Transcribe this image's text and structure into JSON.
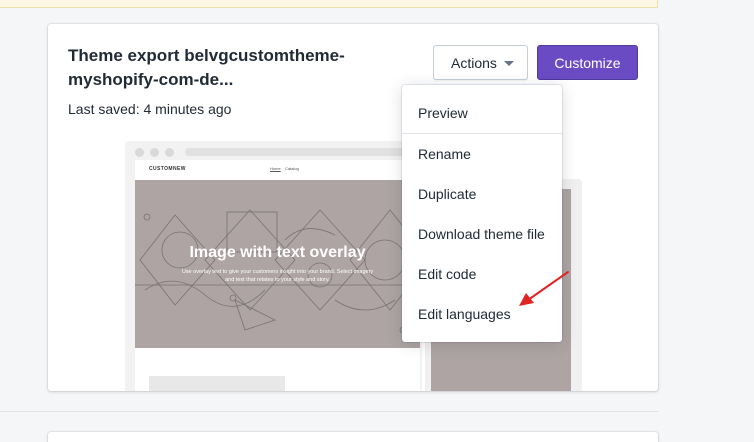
{
  "theme": {
    "title": "Theme export belvgcustomtheme-myshopify-com-de...",
    "last_saved": "Last saved: 4 minutes ago"
  },
  "buttons": {
    "actions_label": "Actions",
    "customize_label": "Customize"
  },
  "preview": {
    "site_logo": "CUSTOMNEW",
    "nav_items": [
      "Home",
      "Catalog"
    ],
    "hero_title": "Image with text overlay",
    "hero_subtitle": "Use overlay text to give your customers insight into your brand. Select imagery and text that relates to your style and story."
  },
  "actions_menu": {
    "items": [
      "Preview",
      "Rename",
      "Duplicate",
      "Download theme file",
      "Edit code",
      "Edit languages"
    ]
  },
  "colors": {
    "primary_button": "#6a4bc4",
    "annotation_arrow": "#e02424",
    "hero_background": "#ada4a3"
  },
  "icons": {
    "actions_caret": "chevron-down-icon",
    "annotation": "red-arrow-icon"
  }
}
